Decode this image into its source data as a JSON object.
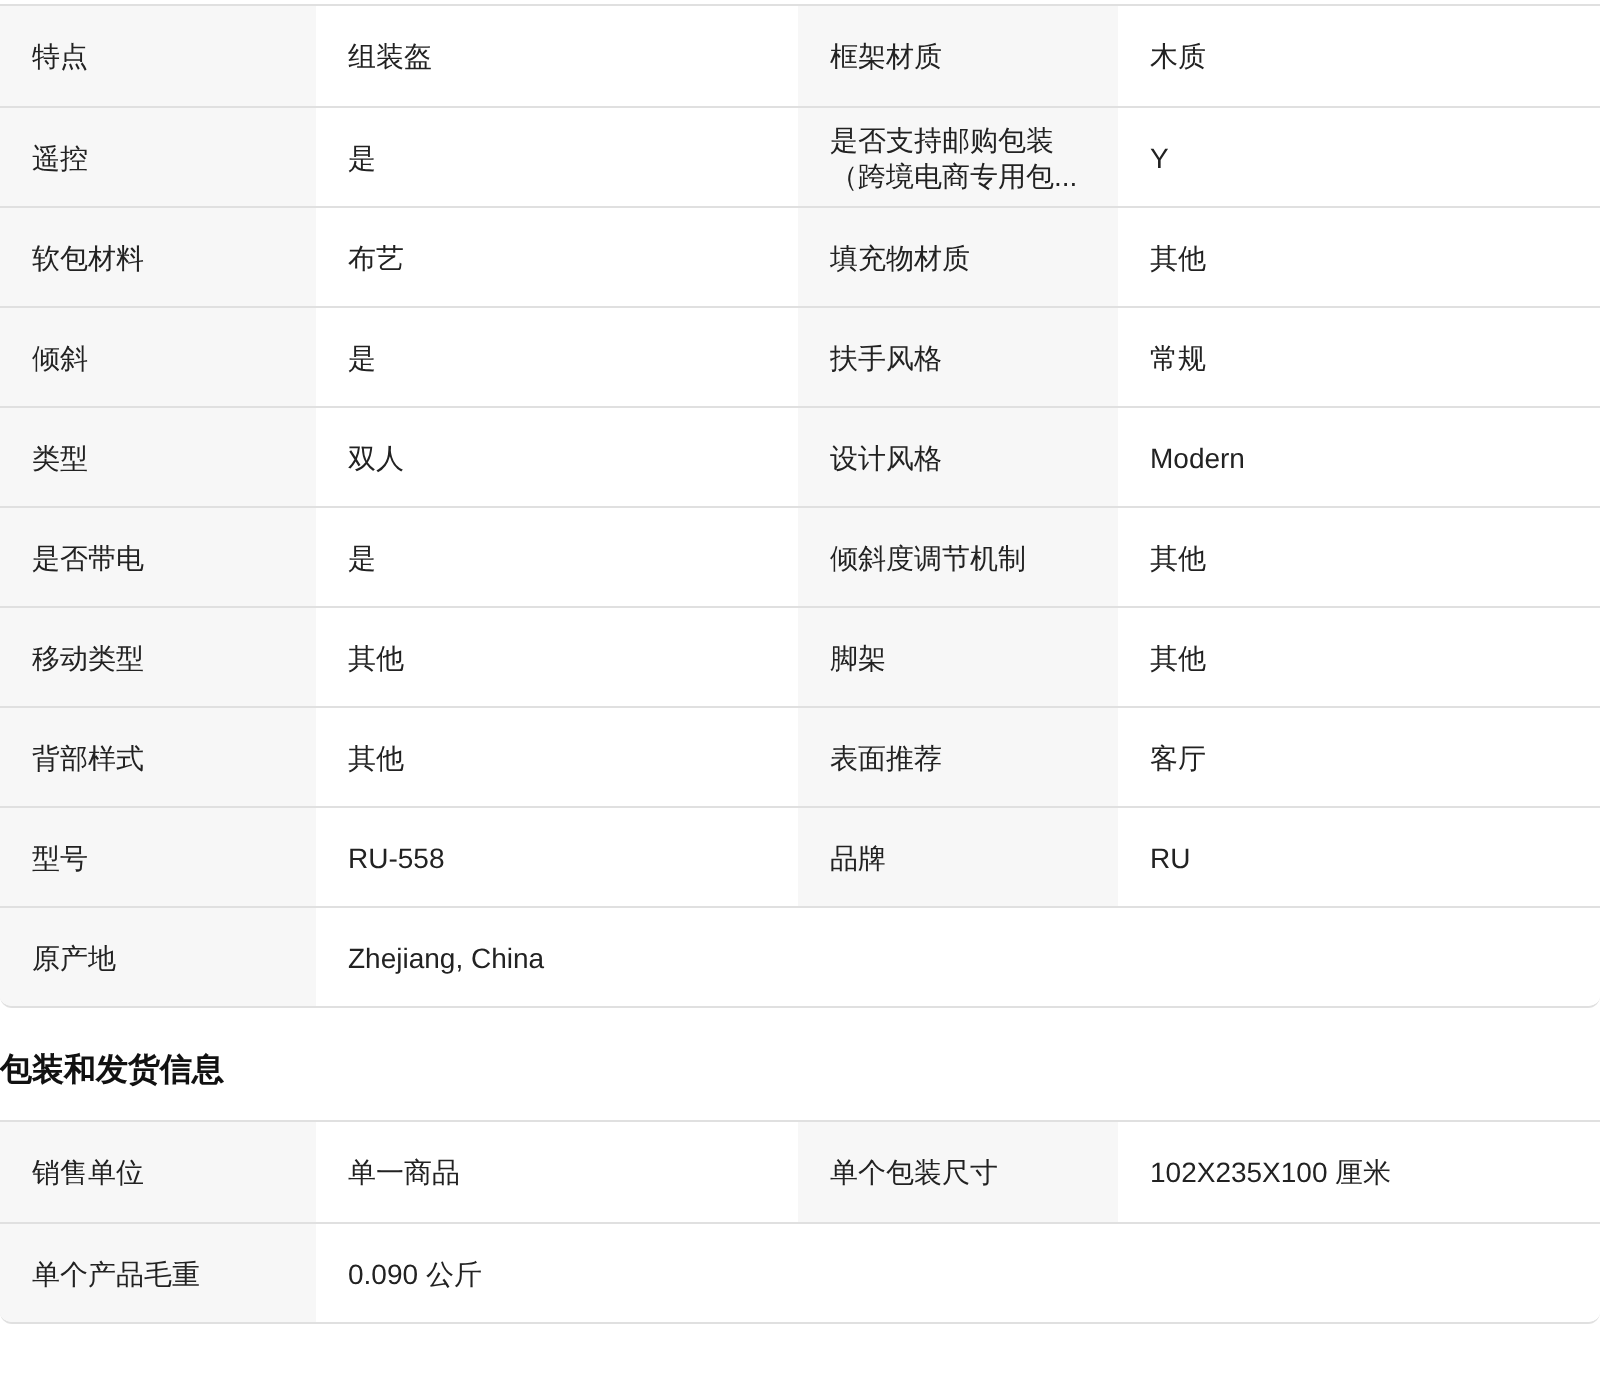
{
  "sections": [
    {
      "rows": [
        [
          {
            "label": "特点",
            "value": "组装盔"
          },
          {
            "label": "框架材质",
            "value": "木质"
          }
        ],
        [
          {
            "label": "遥控",
            "value": "是"
          },
          {
            "label": "是否支持邮购包装（跨境电商专用包...",
            "value": "Y"
          }
        ],
        [
          {
            "label": "软包材料",
            "value": "布艺"
          },
          {
            "label": "填充物材质",
            "value": "其他"
          }
        ],
        [
          {
            "label": "倾斜",
            "value": "是"
          },
          {
            "label": "扶手风格",
            "value": "常规"
          }
        ],
        [
          {
            "label": "类型",
            "value": "双人"
          },
          {
            "label": "设计风格",
            "value": "Modern"
          }
        ],
        [
          {
            "label": "是否带电",
            "value": "是"
          },
          {
            "label": "倾斜度调节机制",
            "value": "其他"
          }
        ],
        [
          {
            "label": "移动类型",
            "value": "其他"
          },
          {
            "label": "脚架",
            "value": "其他"
          }
        ],
        [
          {
            "label": "背部样式",
            "value": "其他"
          },
          {
            "label": "表面推荐",
            "value": "客厅"
          }
        ],
        [
          {
            "label": "型号",
            "value": "RU-558"
          },
          {
            "label": "品牌",
            "value": "RU"
          }
        ],
        [
          {
            "label": "原产地",
            "value": "Zhejiang, China"
          }
        ]
      ]
    },
    {
      "title": "包装和发货信息",
      "rows": [
        [
          {
            "label": "销售单位",
            "value": "单一商品"
          },
          {
            "label": "单个包装尺寸",
            "value": "102X235X100 厘米"
          }
        ],
        [
          {
            "label": "单个产品毛重",
            "value": "0.090 公斤"
          }
        ]
      ]
    }
  ]
}
